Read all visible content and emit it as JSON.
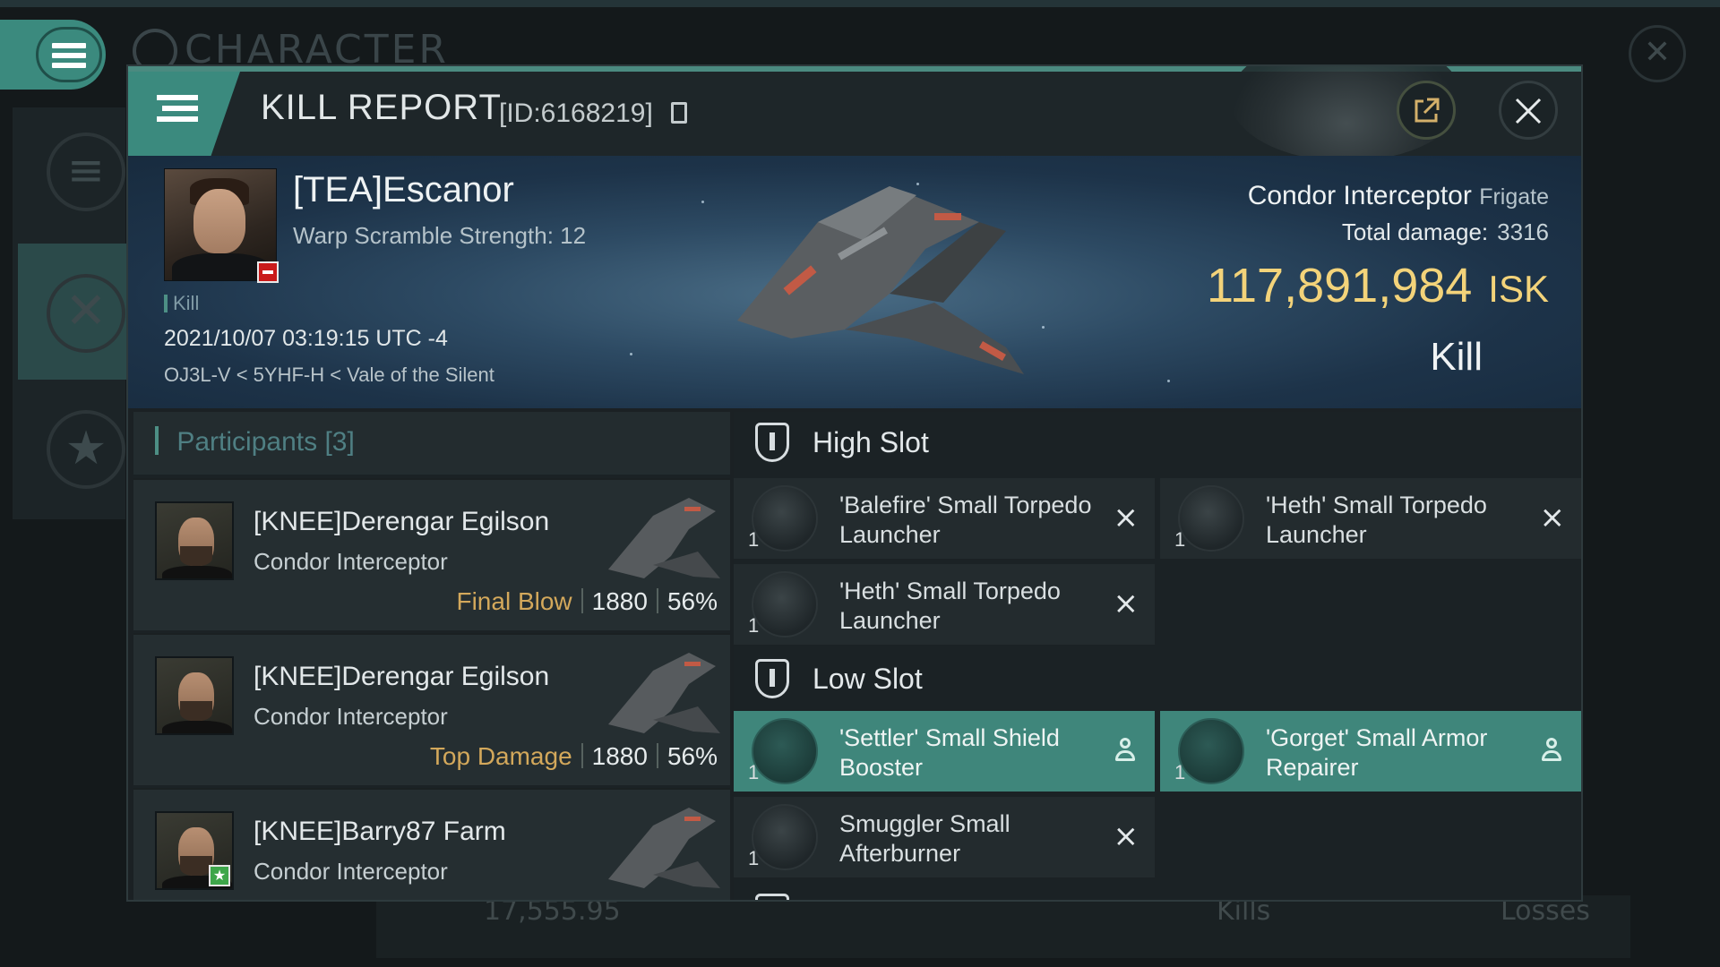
{
  "background": {
    "title": "CHARACTER",
    "bottom_value": "17,555.95",
    "bottom_kills": "Kills",
    "bottom_losses": "Losses"
  },
  "header": {
    "title": "KILL REPORT",
    "id_label": "[ID:6168219]"
  },
  "victim": {
    "name": "[TEA]Escanor",
    "warp_scramble": "Warp Scramble Strength: 12",
    "tag": "Kill",
    "datetime": "2021/10/07 03:19:15 UTC -4",
    "location": "OJ3L-V < 5YHF-H < Vale of the Silent",
    "ship_name": "Condor Interceptor",
    "ship_class": "Frigate",
    "total_damage_label": "Total damage:",
    "total_damage": "3316",
    "isk_value": "117,891,984",
    "isk_unit": "ISK",
    "kill_type": "Kill"
  },
  "participants": {
    "title": "Participants",
    "count": "[3]",
    "rows": [
      {
        "name": "[KNEE]Derengar Egilson",
        "ship": "Condor Interceptor",
        "tag": "Final Blow",
        "damage": "1880",
        "percent": "56%"
      },
      {
        "name": "[KNEE]Derengar Egilson",
        "ship": "Condor Interceptor",
        "tag": "Top Damage",
        "damage": "1880",
        "percent": "56%"
      },
      {
        "name": "[KNEE]Barry87 Farm",
        "ship": "Condor Interceptor"
      }
    ]
  },
  "fitting": {
    "high_slot_label": "High Slot",
    "low_slot_label": "Low Slot",
    "high_modules": [
      {
        "name": "'Balefire' Small Torpedo Launcher",
        "qty": "1",
        "status": "×"
      },
      {
        "name": "'Heth' Small Torpedo Launcher",
        "qty": "1",
        "status": "×"
      },
      {
        "name": "'Heth' Small Torpedo Launcher",
        "qty": "1",
        "status": "×"
      }
    ],
    "low_modules": [
      {
        "name": "'Settler' Small Shield Booster",
        "qty": "1"
      },
      {
        "name": "'Gorget' Small Armor Repairer",
        "qty": "1"
      },
      {
        "name": "Smuggler Small Afterburner",
        "qty": "1",
        "status": "×"
      }
    ]
  },
  "colors": {
    "accent": "#3b8a7e",
    "isk_gold": "#f3d37a",
    "tag_gold": "#d3a85b",
    "loss_badge": "#c91a1a",
    "ally_badge": "#3ea64a"
  },
  "icons": {
    "menu": "hamburger-icon",
    "share": "external-link-icon",
    "close": "close-icon",
    "copy": "copy-icon",
    "slot": "shield-slot-icon",
    "destroyed": "x-mark-icon",
    "dropped": "person-icon"
  }
}
